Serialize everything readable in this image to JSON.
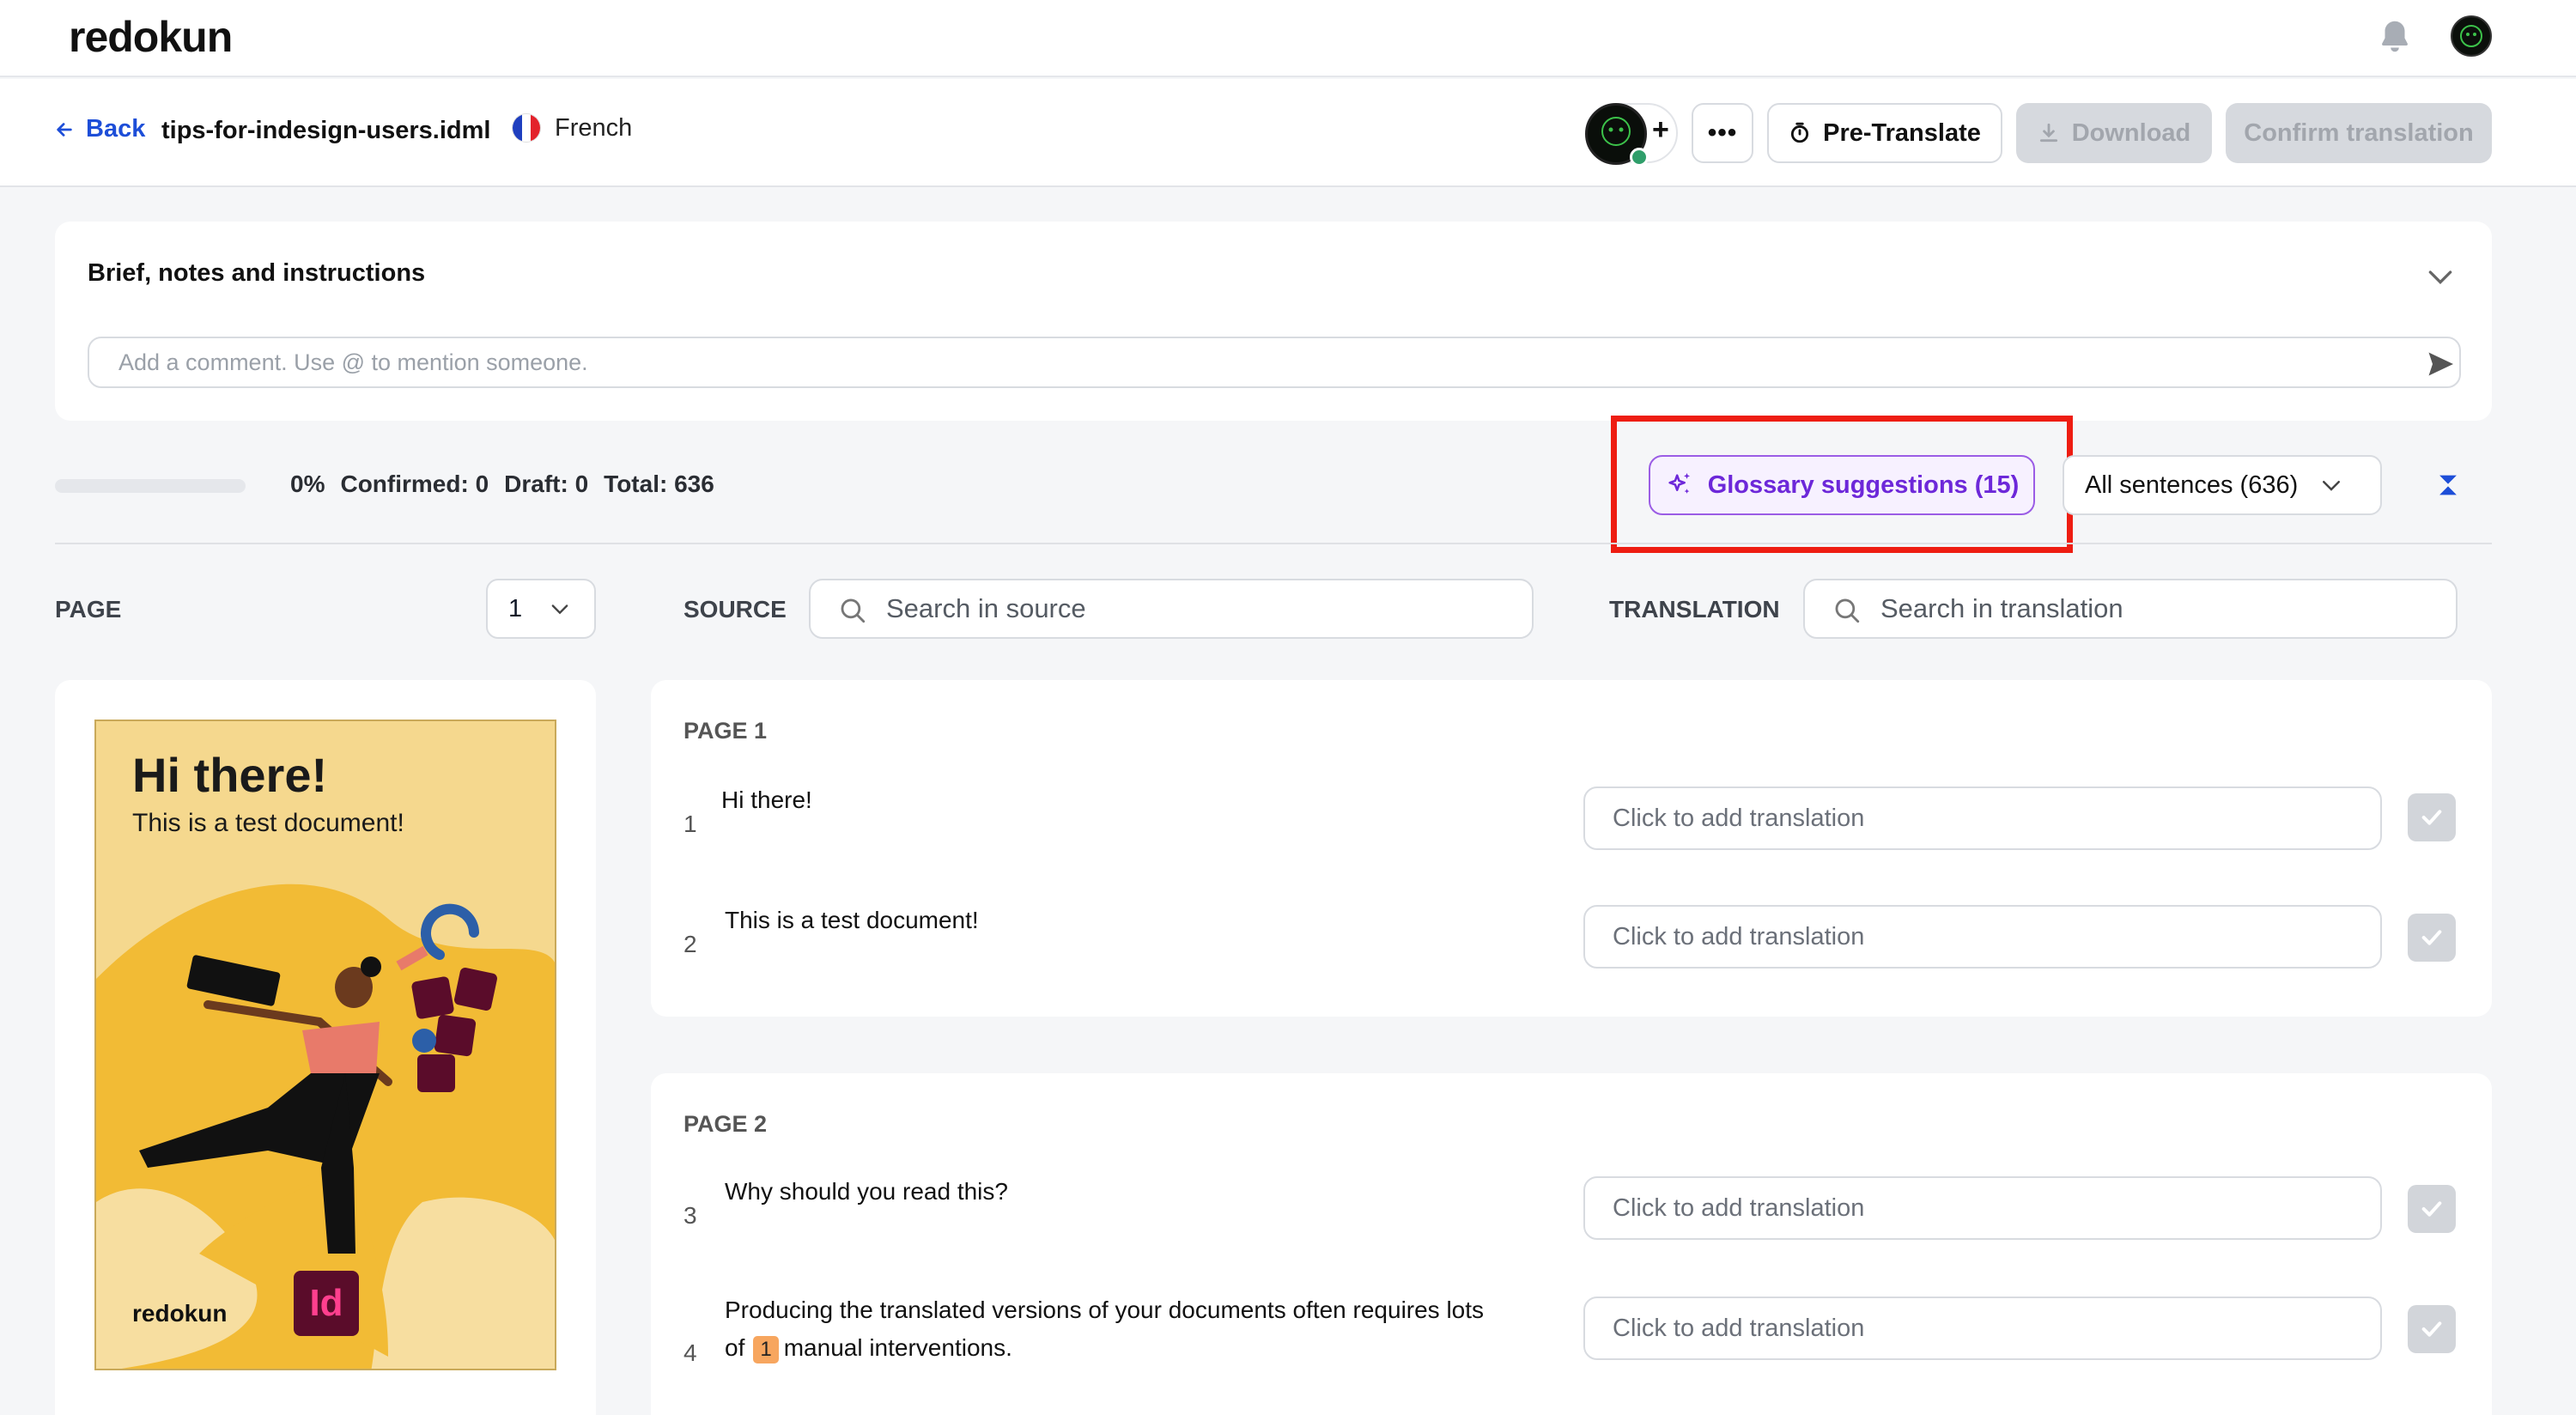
{
  "app": {
    "logo": "redokun"
  },
  "filebar": {
    "back_label": "Back",
    "filename": "tips-for-indesign-users.idml",
    "language": "French",
    "pretranslate_label": "Pre-Translate",
    "download_label": "Download",
    "confirm_label": "Confirm translation"
  },
  "brief": {
    "title": "Brief, notes and instructions",
    "comment_placeholder": "Add a comment. Use @ to mention someone."
  },
  "progress": {
    "percent": 0,
    "percent_label": "0%",
    "confirmed_label": "Confirmed: 0",
    "draft_label": "Draft: 0",
    "total_label": "Total: 636"
  },
  "glossary": {
    "label": "Glossary suggestions (15)"
  },
  "filter": {
    "label": "All sentences (636)"
  },
  "columns": {
    "page_label": "PAGE",
    "page_value": "1",
    "source_label": "SOURCE",
    "source_search_placeholder": "Search in source",
    "translation_label": "TRANSLATION",
    "translation_search_placeholder": "Search in translation"
  },
  "preview": {
    "title": "Hi there!",
    "subtitle": "This is a test document!",
    "logo": "redokun"
  },
  "pages": [
    {
      "heading": "PAGE 1",
      "segments": [
        {
          "num": "1",
          "text": "Hi there!",
          "placeholder": "Click to add translation"
        },
        {
          "num": "2",
          "text": "This is a test document!",
          "placeholder": "Click to add translation"
        }
      ]
    },
    {
      "heading": "PAGE 2",
      "segments": [
        {
          "num": "3",
          "text": "Why should you read this?",
          "placeholder": "Click to add translation"
        },
        {
          "num": "4",
          "text_before": "Producing the translated versions of your documents often requires lots",
          "text_of": "of",
          "tag": "1",
          "text_after": "manual interventions.",
          "placeholder": "Click to add translation"
        }
      ]
    }
  ],
  "colors": {
    "accent": "#1d4ed8",
    "glossary": "#6d28d9",
    "highlight": "#ee1d12",
    "disabled": "#d6d9de"
  }
}
